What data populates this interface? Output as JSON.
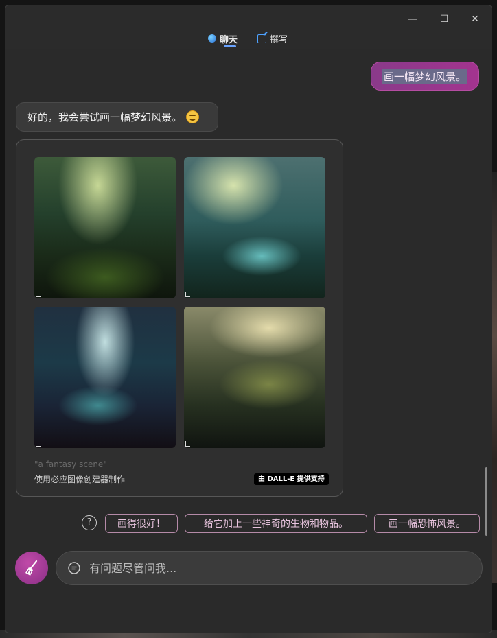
{
  "window": {
    "controls": {
      "minimize": "—",
      "maximize": "☐",
      "close": "✕"
    },
    "tabs": [
      {
        "label": "聊天",
        "active": true,
        "icon": "chat-bubble-icon"
      },
      {
        "label": "撰写",
        "active": false,
        "icon": "compose-icon"
      }
    ]
  },
  "conversation": {
    "user_message": "画一幅梦幻风景。",
    "bot_message": "好的，我会尝试画一幅梦幻风景。",
    "bot_emoji": "smiling-face-emoji",
    "image_card": {
      "prompt": "\"a fantasy scene\"",
      "caption": "使用必应图像创建器制作",
      "badge": "由 DALL-E 提供支持",
      "image_count": 4
    }
  },
  "suggestions": {
    "help_icon": "?",
    "chips": [
      "画得很好！",
      "给它加上一些神奇的生物和物品。",
      "画一幅恐怖风景。"
    ]
  },
  "composer": {
    "placeholder": "有问题尽管问我...",
    "new_topic_icon": "broom-icon",
    "input_icon": "chat-icon"
  },
  "colors": {
    "accent": "#a3348f",
    "chip_border": "#b58aa8",
    "tab_underline": "#6aa3ff"
  }
}
